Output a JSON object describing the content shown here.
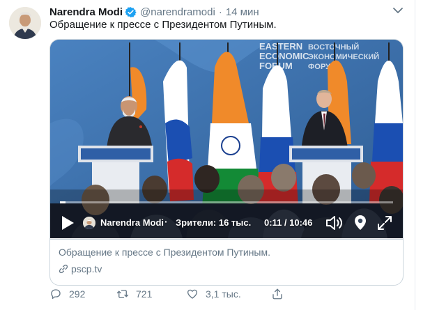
{
  "tweet": {
    "author_name": "Narendra Modi",
    "handle": "@narendramodi",
    "separator": "·",
    "time": "14 мин",
    "text": "Обращение к прессе с Президентом Путиным."
  },
  "video": {
    "author": "Narendra Modi",
    "separator": "·",
    "viewers": "Зрители: 16 тыс.",
    "timecode": "0:11 / 10:46",
    "progress_fraction": 0.017,
    "backdrop_text": [
      "EASTERN",
      "ECONOMIC",
      "FORUM",
      "ВОСТОЧНЫЙ",
      "ЭКОНОМИЧЕСКИЙ",
      "ФОРУМ"
    ]
  },
  "card": {
    "title": "Обращение к прессе с Президентом Путиным.",
    "domain": "pscp.tv"
  },
  "actions": {
    "replies": "292",
    "retweets": "721",
    "likes": "3,1 тыс."
  },
  "colors": {
    "verified": "#1da1f2",
    "secondary_text": "#657786",
    "border": "#ccd6dd",
    "backdrop_blue": "#3b6ea8"
  },
  "icons": [
    "verified-badge-icon",
    "chevron-down-icon",
    "play-icon",
    "volume-icon",
    "location-pin-icon",
    "expand-icon",
    "link-icon",
    "reply-icon",
    "retweet-icon",
    "like-icon",
    "share-icon"
  ]
}
